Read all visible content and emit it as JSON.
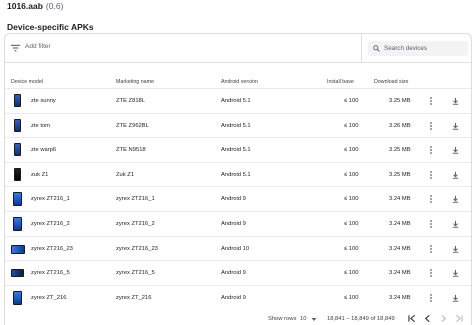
{
  "header": {
    "title": "1016.aab",
    "version": "(0.6)"
  },
  "section": {
    "title": "Device-specific APKs"
  },
  "filter": {
    "label": "Add filter"
  },
  "search": {
    "placeholder": "Search devices"
  },
  "table": {
    "columns": [
      "Device model",
      "Marketing name",
      "Android version",
      "Install base",
      "Download size"
    ],
    "rows": [
      {
        "model": "zte sunny",
        "marketing": "ZTE Z818L",
        "android": "Android 5.1",
        "install": "≤ 100",
        "size": "3.25 MB",
        "thumb": "phone-blue"
      },
      {
        "model": "zte tom",
        "marketing": "ZTE Z962BL",
        "android": "Android 5.1",
        "install": "≤ 100",
        "size": "3.26 MB",
        "thumb": "phone-blue"
      },
      {
        "model": "zte warp6",
        "marketing": "ZTE N9518",
        "android": "Android 5.1",
        "install": "≤ 100",
        "size": "3.25 MB",
        "thumb": "phone-blue"
      },
      {
        "model": "zuk Z1",
        "marketing": "Zuk Z1",
        "android": "Android 5.1",
        "install": "≤ 100",
        "size": "3.25 MB",
        "thumb": "phone-dark"
      },
      {
        "model": "zyrex ZT216_1",
        "marketing": "zyrex ZT216_1",
        "android": "Android 9",
        "install": "≤ 100",
        "size": "3.24 MB",
        "thumb": "tablet-blue"
      },
      {
        "model": "zyrex ZT216_2",
        "marketing": "zyrex ZT216_2",
        "android": "Android 9",
        "install": "≤ 100",
        "size": "3.24 MB",
        "thumb": "tablet-blue"
      },
      {
        "model": "zyrex ZT216_23",
        "marketing": "zyrex ZT216_23",
        "android": "Android 10",
        "install": "≤ 100",
        "size": "3.24 MB",
        "thumb": "tablet-landscape"
      },
      {
        "model": "zyrex ZT216_5",
        "marketing": "zyrex ZT216_5",
        "android": "Android 9",
        "install": "≤ 100",
        "size": "3.24 MB",
        "thumb": "tablet-landscape-dark"
      },
      {
        "model": "zyrex ZT_216",
        "marketing": "zyrex ZT_216",
        "android": "Android 9",
        "install": "≤ 100",
        "size": "3.24 MB",
        "thumb": "tablet-blue"
      }
    ]
  },
  "footer": {
    "rows_label": "Show rows",
    "rows_value": "10",
    "range": "18,841 – 18,849 of 18,849"
  },
  "icons": {
    "filter": "filter-icon",
    "search": "search-icon",
    "more": "more-vert-icon",
    "download": "download-icon",
    "first_page": "first-page-icon",
    "prev_page": "chevron-left-icon",
    "next_page": "chevron-right-icon",
    "last_page": "last-page-icon"
  },
  "colors": {
    "text": "#202124",
    "muted": "#5f6368",
    "divider": "#e0e0e0",
    "search_bg": "#f1f3f4"
  }
}
